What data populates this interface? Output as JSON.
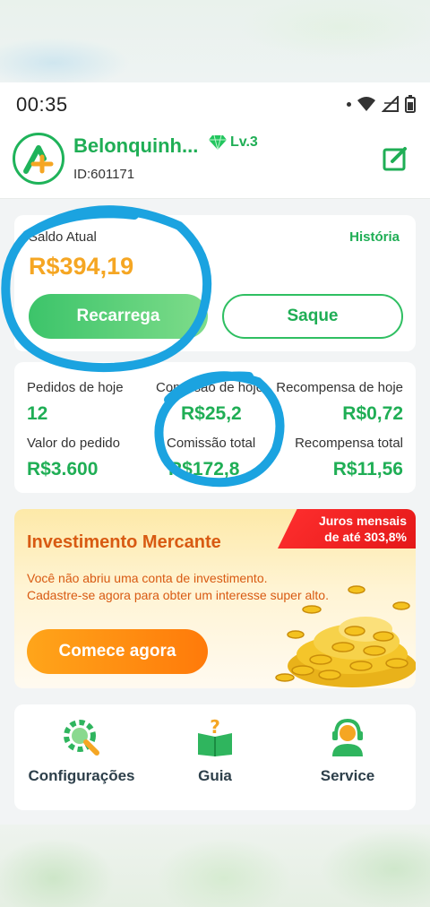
{
  "status_bar": {
    "time": "00:35"
  },
  "profile": {
    "username": "Belonquinh...",
    "level": "Lv.3",
    "user_id": "ID:601171"
  },
  "balance": {
    "label": "Saldo Atual",
    "value": "R$394,19",
    "history_link": "História",
    "recharge_button": "Recarrega",
    "withdraw_button": "Saque"
  },
  "stats": {
    "orders_today_label": "Pedidos de hoje",
    "orders_today_value": "12",
    "commission_today_label": "Comissão de hoje",
    "commission_today_value": "R$25,2",
    "reward_today_label": "Recompensa de hoje",
    "reward_today_value": "R$0,72",
    "order_value_label": "Valor do pedido",
    "order_value_value": "R$3.600",
    "commission_total_label": "Comissão total",
    "commission_total_value": "R$172,8",
    "reward_total_label": "Recompensa total",
    "reward_total_value": "R$11,56"
  },
  "investment": {
    "badge_line1": "Juros mensais",
    "badge_line2": "de até 303,8%",
    "title": "Investimento Mercante",
    "desc_line1": "Você não abriu uma conta de investimento.",
    "desc_line2": "Cadastre-se agora para obter um interesse super alto.",
    "cta_button": "Comece agora"
  },
  "menu": {
    "settings": "Configurações",
    "guide": "Guia",
    "service": "Service"
  },
  "colors": {
    "brand_green": "#1fae55",
    "balance_orange": "#f5a623",
    "invest_orange": "#d85a12",
    "badge_red": "#e41818",
    "marker_blue": "#1ba3e0"
  },
  "icons": [
    "wifi-icon",
    "signal-icon",
    "battery-icon",
    "logo-icon",
    "diamond-icon",
    "edit-icon",
    "gear-icon",
    "guide-icon",
    "service-icon",
    "coins-image"
  ]
}
